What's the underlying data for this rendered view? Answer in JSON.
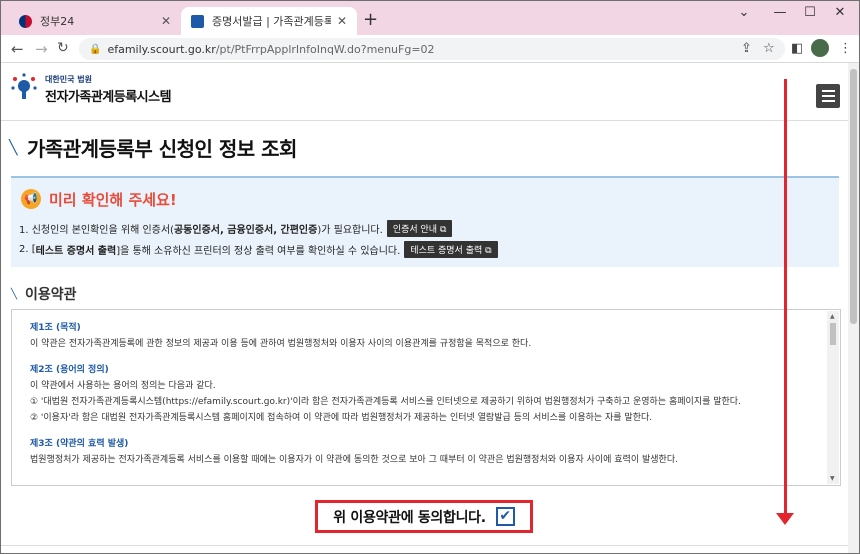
{
  "browser": {
    "tabs": [
      {
        "title": "정부24",
        "icon": "korea-emblem-icon"
      },
      {
        "title": "증명서발급 | 가족관계등록부 |",
        "icon": "court-icon"
      }
    ],
    "new_tab_symbol": "+",
    "close_symbol": "✕",
    "url_host": "efamily.scourt.go.kr",
    "url_path": "/pt/PtFrrpApplrInfoInqW.do?menuFg=02",
    "window_controls": [
      "⌄",
      "—",
      "☐",
      "✕"
    ]
  },
  "site": {
    "logo_sub": "대한민국 법원",
    "logo_main": "전자가족관계등록시스템"
  },
  "page_title": "가족관계등록부 신청인 정보 조회",
  "notice": {
    "title": "미리 확인해 주세요!",
    "line1_prefix": "1. 신청인의 본인확인을 위해 인증서(",
    "line1_bold": "공동인증서, 금융인증서, 간편인증",
    "line1_suffix": ")가 필요합니다.",
    "line1_button": "인증서 안내",
    "line2_prefix": "2. [",
    "line2_bold": "테스트 증명서 출력",
    "line2_suffix": "]을 통해 소유하신 프린터의 정상 출력 여부를 확인하실 수 있습니다.",
    "line2_button": "테스트 증명서 출력"
  },
  "terms_section": {
    "title": "이용약관",
    "articles": [
      {
        "heading": "제1조 (목적)",
        "lines": [
          "이 약관은 전자가족관계등록에 관한 정보의 제공과 이용 등에 관하여 법원행정처와 이용자 사이의 이용관계를 규정함을 목적으로 한다."
        ]
      },
      {
        "heading": "제2조 (용어의 정의)",
        "lines": [
          "이 약관에서 사용하는 용어의 정의는 다음과 같다.",
          "① '대법원 전자가족관계등록시스템(https://efamily.scourt.go.kr)'이라 함은 전자가족관계등록 서비스를 인터넷으로 제공하기 위하여 법원행정처가 구축하고 운영하는 홈페이지를 말한다.",
          "② '이용자'라 함은 대법원 전자가족관계등록시스템 홈페이지에 접속하여 이 약관에 따라 법원행정처가 제공하는 인터넷 열람발급 등의 서비스를 이용하는 자를 말한다."
        ]
      },
      {
        "heading": "제3조 (약관의 효력 발생)",
        "lines": [
          "법원행정처가 제공하는 전자가족관계등록 서비스를 이용할 때에는 이용자가 이 약관에 동의한 것으로 보아 그 때부터 이 약관은 법원행정처와 이용자 사이에 효력이 발생한다."
        ]
      }
    ]
  },
  "agree": {
    "label": "위 이용약관에 동의합니다.",
    "checked": true,
    "check_symbol": "✔"
  },
  "colors": {
    "accent_blue": "#1e5aa8",
    "highlight_red": "#e3262d",
    "notice_title": "#e74c3c",
    "tab_bar": "#f3d6e4"
  }
}
